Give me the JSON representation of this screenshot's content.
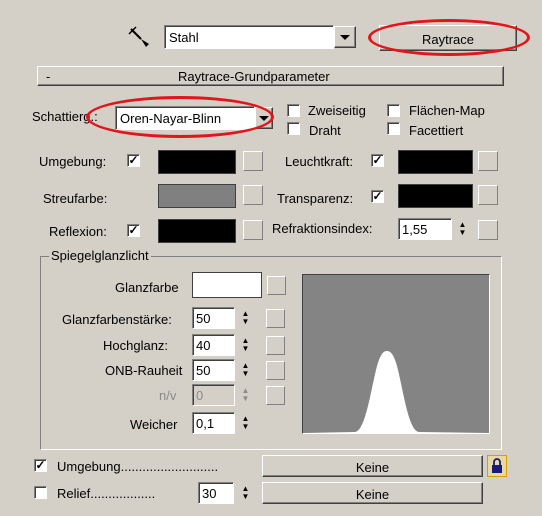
{
  "top": {
    "material_name": "Stahl",
    "type_button": "Raytrace"
  },
  "rollout": {
    "collapse": "-",
    "title": "Raytrace-Grundparameter"
  },
  "shader": {
    "label": "Schattierg.:",
    "selected": "Oren-Nayar-Blinn",
    "options": [
      {
        "label": "Zweiseitig",
        "checked": false
      },
      {
        "label": "Flächen-Map",
        "checked": false
      },
      {
        "label": "Draht",
        "checked": false
      },
      {
        "label": "Facettiert",
        "checked": false
      }
    ]
  },
  "colors": {
    "umgebung": {
      "label": "Umgebung:",
      "checked": true,
      "color": "#000000"
    },
    "streufarbe": {
      "label": "Streufarbe:",
      "color": "#808080"
    },
    "reflexion": {
      "label": "Reflexion:",
      "checked": true,
      "color": "#000000"
    },
    "leuchtkraft": {
      "label": "Leuchtkraft:",
      "checked": true,
      "color": "#000000"
    },
    "transparenz": {
      "label": "Transparenz:",
      "checked": true,
      "color": "#000000"
    },
    "refraktion": {
      "label": "Refraktionsindex:",
      "value": "1,55"
    }
  },
  "specular": {
    "group_label": "Spiegelglanzlicht",
    "glanzfarbe_label": "Glanzfarbe",
    "glanzfarbe_color": "#ffffff",
    "fields": [
      {
        "label": "Glanzfarbenstärke:",
        "value": "50",
        "disabled": false
      },
      {
        "label": "Hochglanz:",
        "value": "40",
        "disabled": false
      },
      {
        "label": "ONB-Rauheit",
        "value": "50",
        "disabled": false
      },
      {
        "label": "n/v",
        "value": "0",
        "disabled": true
      },
      {
        "label": "Weicher",
        "value": "0,1",
        "disabled": false
      }
    ]
  },
  "maps": [
    {
      "label": "Umgebung...........................",
      "checked": true,
      "button": "Keine",
      "locked": true
    },
    {
      "label": "Relief..................",
      "checked": false,
      "amount": "30",
      "button": "Keine"
    }
  ],
  "accent_colors": {
    "highlight_oval": "#e0161b",
    "lock": "#d4a000"
  }
}
